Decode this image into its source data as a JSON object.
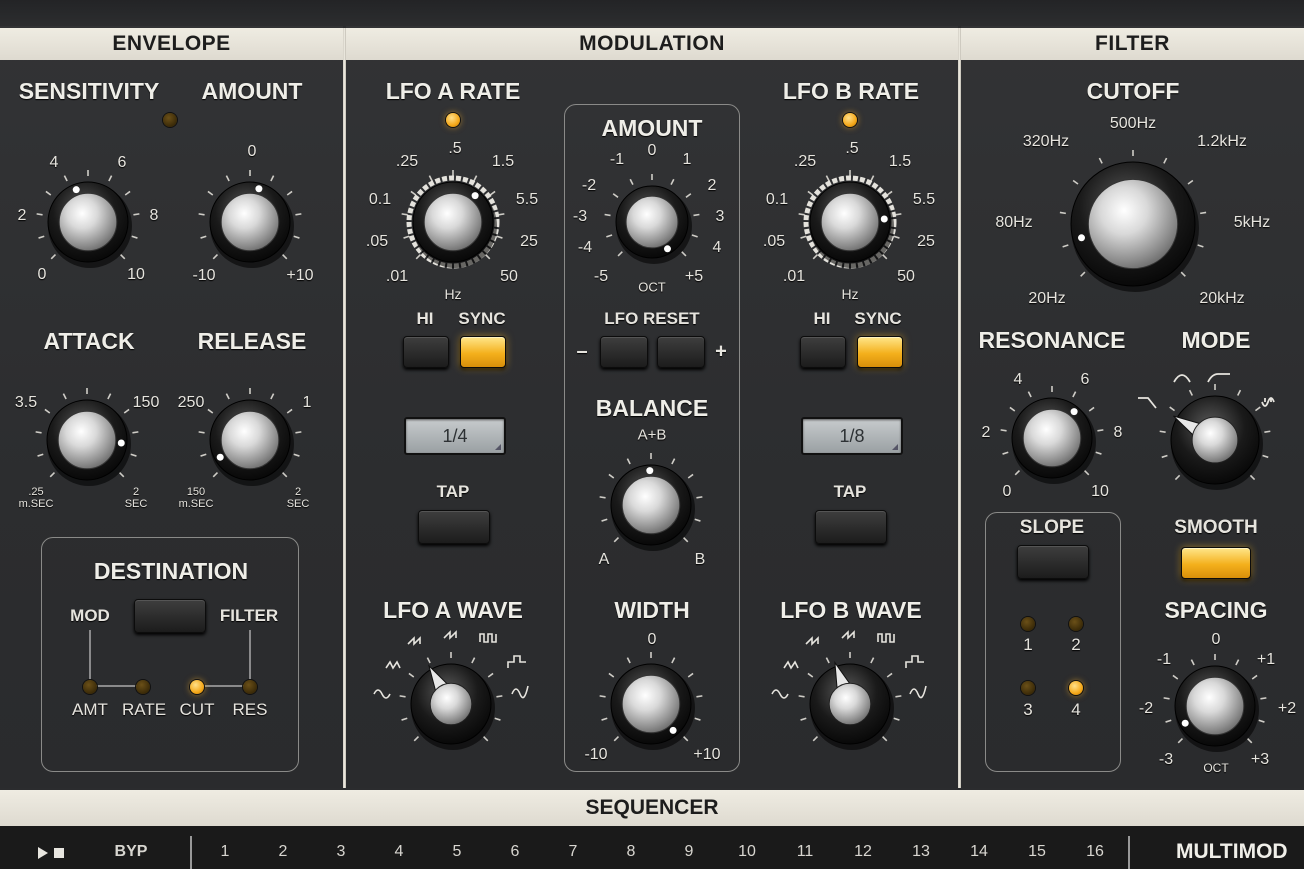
{
  "sections": {
    "envelope": "ENVELOPE",
    "modulation": "MODULATION",
    "filter": "FILTER",
    "sequencer": "SEQUENCER"
  },
  "colors": {
    "panel": "#2c2d2f",
    "header": "#e8e5db",
    "led_on": "#f5a819",
    "button_on": "#f4b01c"
  },
  "envelope": {
    "sensitivity": {
      "label": "SENSITIVITY",
      "scale": [
        "0",
        "2",
        "4",
        "6",
        "8",
        "10"
      ]
    },
    "amount": {
      "label": "AMOUNT",
      "scale": [
        "-10",
        "0",
        "+10"
      ]
    },
    "attack": {
      "label": "ATTACK",
      "scale": [
        "3.5",
        "150",
        ".25",
        "2"
      ],
      "unit_left": "m.SEC",
      "unit_right": "SEC"
    },
    "release": {
      "label": "RELEASE",
      "scale": [
        "250",
        "1",
        "150",
        "2"
      ],
      "unit_left": "m.SEC",
      "unit_right": "SEC"
    },
    "destination": {
      "label": "DESTINATION",
      "mod": "MOD",
      "filter": "FILTER",
      "leds": [
        "AMT",
        "RATE",
        "CUT",
        "RES"
      ]
    }
  },
  "modulation": {
    "lfo_a": {
      "label": "LFO A RATE",
      "scale": [
        ".25",
        ".5",
        "1.5",
        "0.1",
        "5.5",
        ".05",
        "25",
        ".01",
        "50"
      ],
      "unit": "Hz",
      "hi": "HI",
      "sync": "SYNC",
      "display": "1/4",
      "tap": "TAP",
      "wave_label": "LFO A WAVE"
    },
    "lfo_b": {
      "label": "LFO B RATE",
      "scale": [
        ".25",
        ".5",
        "1.5",
        "0.1",
        "5.5",
        ".05",
        "25",
        ".01",
        "50"
      ],
      "unit": "Hz",
      "hi": "HI",
      "sync": "SYNC",
      "display": "1/8",
      "tap": "TAP",
      "wave_label": "LFO B WAVE"
    },
    "amount": {
      "label": "AMOUNT",
      "scale": [
        "-1",
        "0",
        "1",
        "-2",
        "2",
        "-3",
        "3",
        "-4",
        "4",
        "-5",
        "+5"
      ],
      "unit": "OCT"
    },
    "lfo_reset": {
      "label": "LFO RESET",
      "minus": "–",
      "plus": "+"
    },
    "balance": {
      "label": "BALANCE",
      "top": "A+B",
      "left": "A",
      "right": "B"
    },
    "width": {
      "label": "WIDTH",
      "scale": [
        "0",
        "-10",
        "+10"
      ]
    }
  },
  "filter": {
    "cutoff": {
      "label": "CUTOFF",
      "scale": [
        "320Hz",
        "500Hz",
        "1.2kHz",
        "80Hz",
        "5kHz",
        "20Hz",
        "20kHz"
      ]
    },
    "resonance": {
      "label": "RESONANCE",
      "scale": [
        "4",
        "6",
        "2",
        "8",
        "0",
        "10"
      ]
    },
    "mode": {
      "label": "MODE"
    },
    "slope": {
      "label": "SLOPE",
      "leds": [
        "1",
        "2",
        "3",
        "4"
      ]
    },
    "smooth": {
      "label": "SMOOTH"
    },
    "spacing": {
      "label": "SPACING",
      "scale": [
        "0",
        "-1",
        "+1",
        "-2",
        "+2",
        "-3",
        "+3"
      ],
      "unit": "OCT"
    }
  },
  "sequencer": {
    "bypass": "BYP",
    "steps": [
      "1",
      "2",
      "3",
      "4",
      "5",
      "6",
      "7",
      "8",
      "9",
      "10",
      "11",
      "12",
      "13",
      "14",
      "15",
      "16"
    ],
    "mode_title": "MULTIMOD"
  }
}
